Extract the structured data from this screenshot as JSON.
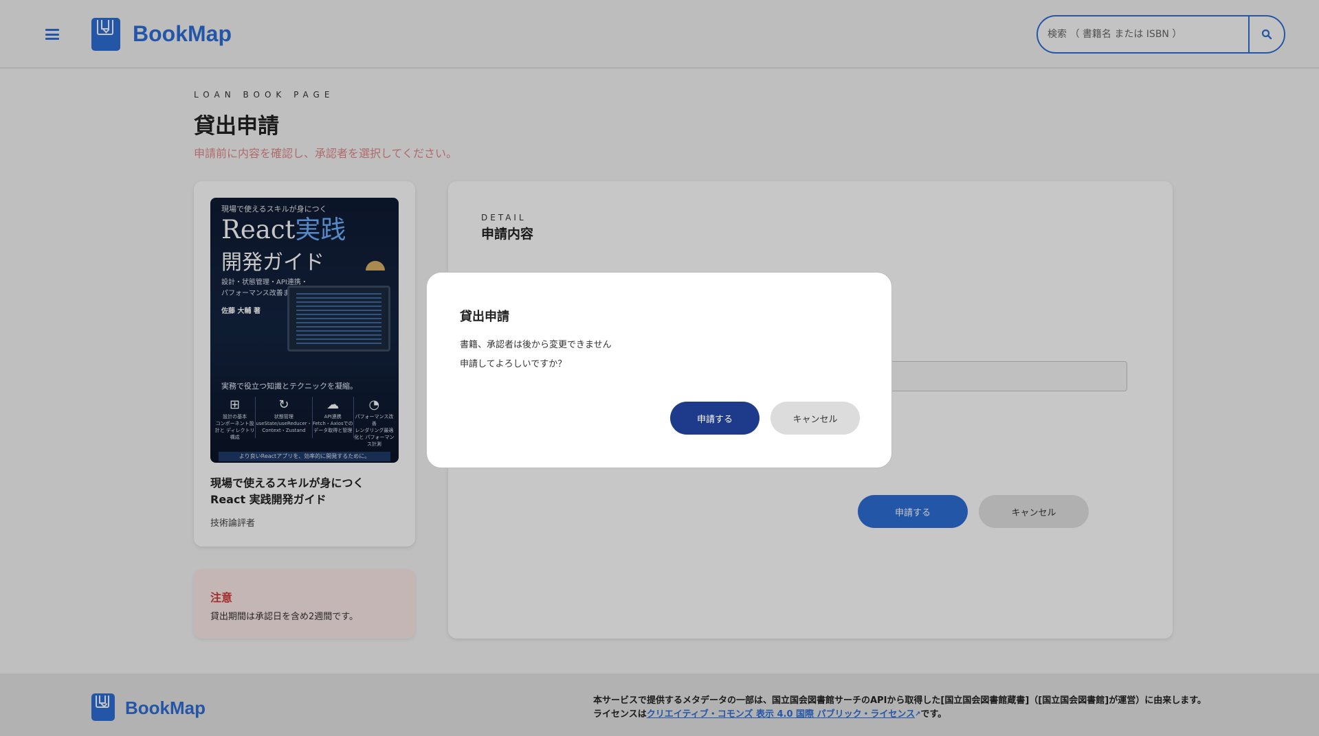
{
  "header": {
    "app_name": "BookMap",
    "search_placeholder": "検索 （ 書籍名 または ISBN ）"
  },
  "page": {
    "eyebrow": "LOAN BOOK PAGE",
    "title": "貸出申請",
    "subtitle": "申請前に内容を確認し、承認者を選択してください。"
  },
  "book": {
    "title": "現場で使えるスキルが身につく React 実践開発ガイド",
    "author": "技術論評者",
    "cover": {
      "tagline": "現場で使えるスキルが身につく",
      "title_main": "React",
      "title_accent": "実践",
      "title_line2": "開発ガイド",
      "subtitle_line1": "設計・状態管理・API連携・",
      "subtitle_line2": "パフォーマンス改善まで",
      "author": "佐藤 大輔 著",
      "catchphrase": "実務で役立つ知識とテクニックを凝縮。",
      "features": [
        {
          "label": "設計の基本",
          "desc": "コンポーネント設計と ディレクトリ構成"
        },
        {
          "label": "状態管理",
          "desc": "useState/useReducer・ Context・Zustand"
        },
        {
          "label": "API連携",
          "desc": "Fetch・Axiosでの データ取得と管理"
        },
        {
          "label": "パフォーマンス改善",
          "desc": "レンダリング最適化と パフォーマンス計測"
        }
      ],
      "band": "より良いReactアプリを、効率的に開発するために。"
    }
  },
  "notice": {
    "title": "注意",
    "body": "貸出期間は承認日を含め2週間です。"
  },
  "detail": {
    "eyebrow": "DETAIL",
    "title": "申請内容",
    "submit_label": "申請する",
    "cancel_label": "キャンセル"
  },
  "modal": {
    "title": "貸出申請",
    "line1": "書籍、承認者は後から変更できません",
    "line2": "申請してよろしいですか？",
    "confirm_label": "申請する",
    "cancel_label": "キャンセル"
  },
  "footer": {
    "app_name": "BookMap",
    "line1": "本サービスで提供するメタデータの一部は、国立国会図書館サーチのAPIから取得した[国立国会図書館蔵書]（[国立国会図書館]が運営）に由来します。",
    "line2_prefix": "ライセンスは",
    "license_link": "クリエイティブ・コモンズ 表示 4.0 国際 パブリック・ライセンス",
    "line2_suffix": "です。"
  },
  "colors": {
    "brand": "#2f6fd6",
    "modal_primary": "#1e3a8a",
    "notice_bg": "#fdeaea",
    "notice_title": "#d23b3b",
    "subtitle": "#e08a8a"
  }
}
